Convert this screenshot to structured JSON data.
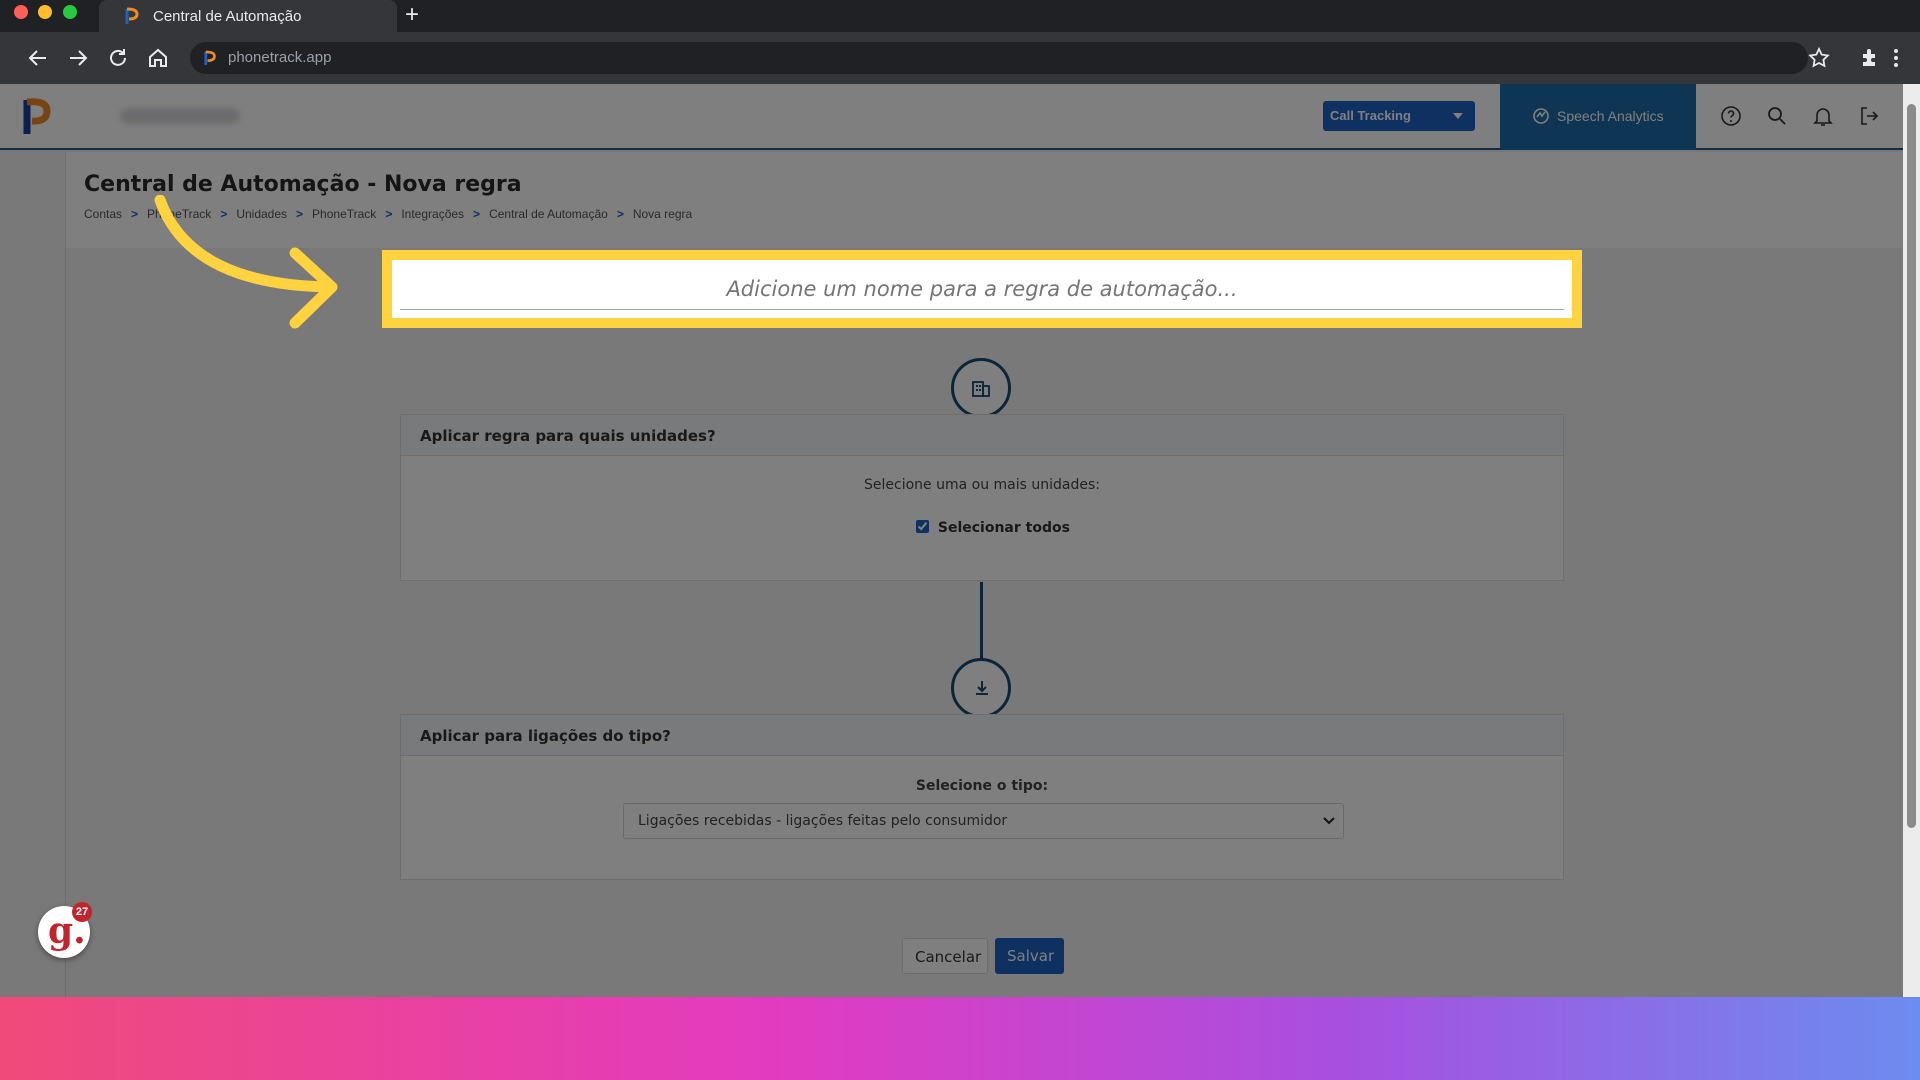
{
  "browser": {
    "tab_title": "Central de Automação",
    "url": "phonetrack.app"
  },
  "header": {
    "product_select": "Call Tracking",
    "speech_analytics": "Speech Analytics"
  },
  "page": {
    "title": "Central de Automação - Nova regra",
    "breadcrumb": [
      "Contas",
      "PhoneTrack",
      "Unidades",
      "PhoneTrack",
      "Integrações",
      "Central de Automação",
      "Nova regra"
    ],
    "breadcrumb_separator": ">"
  },
  "rule_name": {
    "placeholder": "Adicione um nome para a regra de automação..."
  },
  "units_card": {
    "title": "Aplicar regra para quais unidades?",
    "instruction": "Selecione uma ou mais unidades:",
    "select_all_label": "Selecionar todos",
    "select_all_checked": true
  },
  "call_type_card": {
    "title": "Aplicar para ligações do tipo?",
    "label": "Selecione o tipo:",
    "selected": "Ligações recebidas - ligações feitas pelo consumidor"
  },
  "actions": {
    "cancel": "Cancelar",
    "save": "Salvar"
  },
  "widget": {
    "letter": "g.",
    "count": "27"
  },
  "colors": {
    "highlight": "#ffd23f",
    "primary": "#1d63c5",
    "dark_blue": "#1a4a72",
    "annotation_arrow": "#ffd23f"
  }
}
